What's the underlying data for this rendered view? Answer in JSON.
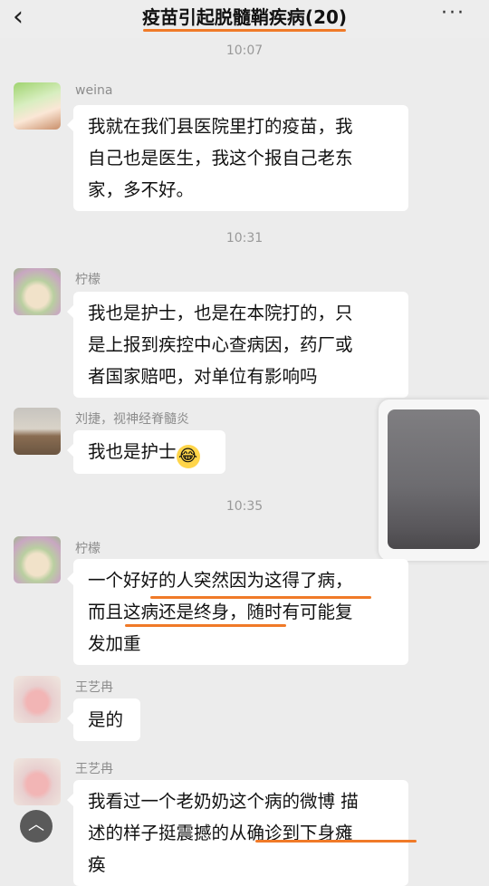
{
  "header": {
    "back_icon": "chevron-left-icon",
    "title": "疫苗引起脱髓鞘疾病(20)",
    "more_icon": "more-dots-icon",
    "accent": "#f07a28"
  },
  "timestamps": [
    "10:07",
    "10:31",
    "10:35"
  ],
  "messages": [
    {
      "sender": "weina",
      "lines": [
        "我就在我们县医院里打的疫苗，我",
        "自己也是医生，我这个报自己老东",
        "家，多不好。"
      ]
    },
    {
      "sender": "柠檬",
      "lines": [
        "我也是护士，也是在本院打的，只",
        "是上报到疾控中心查病因，药厂或",
        "者国家赔吧，对单位有影响吗"
      ]
    },
    {
      "sender": "刘捷，视神经脊髓炎",
      "text": "我也是护士",
      "emoji": "😂"
    },
    {
      "sender": "柠檬",
      "lines": [
        "一个好好的人突然因为这得了病，",
        "而且这病还是终身，随时有可能复",
        "发加重"
      ]
    },
    {
      "sender": "王艺冉",
      "text": "是的"
    },
    {
      "sender": "王艺冉",
      "lines": [
        "我看过一个老奶奶这个病的微博 描",
        "述的样子挺震撼的从确诊到下身瘫",
        "痪"
      ]
    }
  ],
  "floating_photo": {
    "name": "video-thumbnail"
  },
  "scroll_top_icon": "arrow-up-icon"
}
